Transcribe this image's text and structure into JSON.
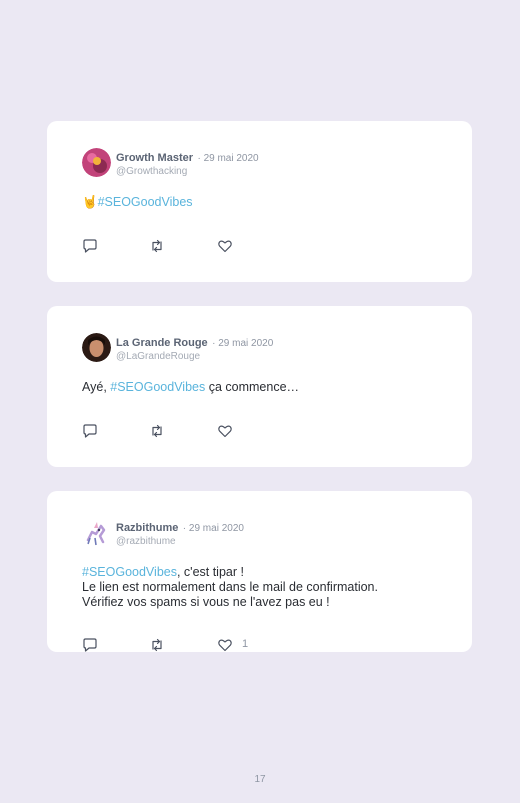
{
  "tweets": [
    {
      "name": "Growth Master",
      "date": "· 29 mai 2020",
      "handle": "@Growthacking",
      "body_emoji": "🤘",
      "body_tag": "#SEOGoodVibes",
      "icons": [
        "reply-icon",
        "retweet-icon",
        "like-icon"
      ]
    },
    {
      "name": "La Grande Rouge",
      "date": "· 29 mai 2020",
      "handle": "@LaGrandeRouge",
      "body_prefix": "Ayé, ",
      "body_tag": "#SEOGoodVibes",
      "body_suffix": " ça commence…",
      "icons": [
        "reply-icon",
        "retweet-icon",
        "like-icon"
      ]
    },
    {
      "name": "Razbithume",
      "date": "· 29 mai 2020",
      "handle": "@razbithume",
      "body_tag": "#SEOGoodVibes",
      "body_suffix": ", c'est tipar !",
      "body_line2": "Le lien est normalement dans le mail de confirmation.",
      "body_line3": "Vérifiez vos spams si vous ne l'avez pas eu !",
      "like_count": "1",
      "icons": [
        "reply-icon",
        "retweet-icon",
        "like-icon"
      ]
    }
  ],
  "page_number": "17",
  "colors": {
    "hashtag": "#5ab4dc",
    "background": "#ebe8f3",
    "card": "#ffffff"
  }
}
